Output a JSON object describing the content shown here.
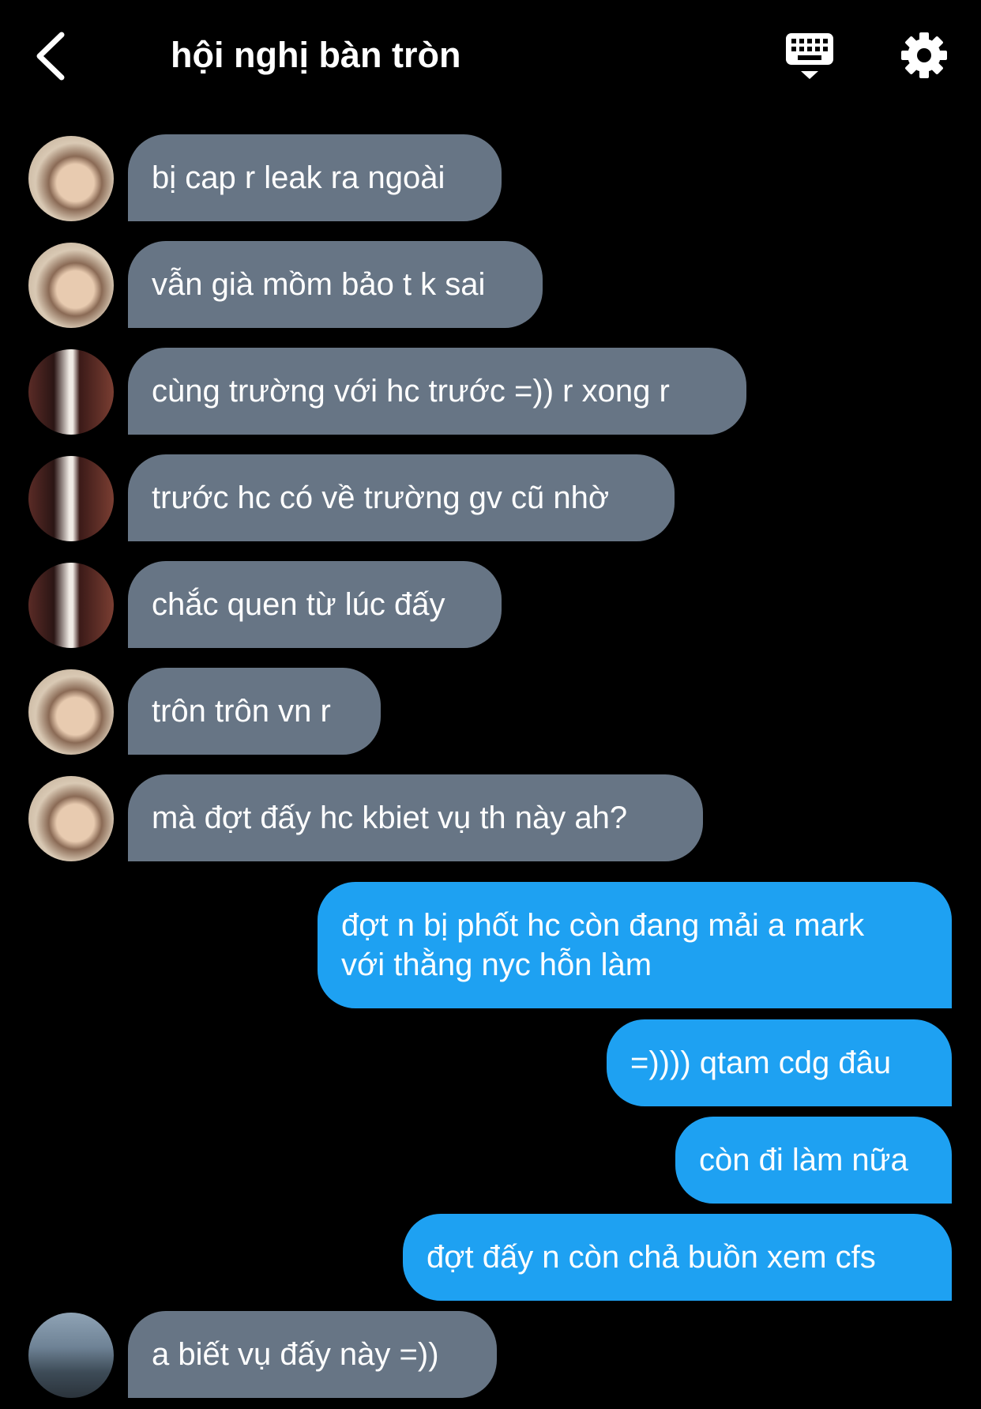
{
  "header": {
    "title": "hội nghị bàn tròn",
    "back_icon": "chevron-left-icon",
    "keyboard_icon": "keyboard-icon",
    "settings_icon": "gear-icon"
  },
  "colors": {
    "background": "#000000",
    "incoming_bubble": "#677585",
    "outgoing_bubble": "#1ea1f2",
    "text": "#ffffff"
  },
  "messages": [
    {
      "side": "in",
      "avatar": "a",
      "text": "bị cap r leak ra ngoài"
    },
    {
      "side": "in",
      "avatar": "a",
      "text": "vẫn già mồm bảo t k sai"
    },
    {
      "side": "in",
      "avatar": "b",
      "text": "cùng trường với hc trước =)) r xong r"
    },
    {
      "side": "in",
      "avatar": "b",
      "text": "trước hc có về trường gv cũ nhờ"
    },
    {
      "side": "in",
      "avatar": "b",
      "text": "chắc quen từ lúc đấy"
    },
    {
      "side": "in",
      "avatar": "a",
      "text": "trôn trôn vn r"
    },
    {
      "side": "in",
      "avatar": "a",
      "text": "mà đợt đấy hc kbiet vụ th này ah?"
    },
    {
      "side": "out",
      "text": "đợt n bị phốt hc còn đang mải a mark với thằng nyc hỗn làm",
      "lines": [
        "đợt n bị phốt hc còn đang mải a mark",
        "với thằng nyc hỗn làm"
      ]
    },
    {
      "side": "out",
      "text": "=)))) qtam cdg đâu"
    },
    {
      "side": "out",
      "text": "còn đi làm nữa"
    },
    {
      "side": "out",
      "text": "đợt đấy n còn chả buồn xem cfs"
    },
    {
      "side": "in",
      "avatar": "c",
      "text": "a biết vụ đấy này =))"
    }
  ]
}
